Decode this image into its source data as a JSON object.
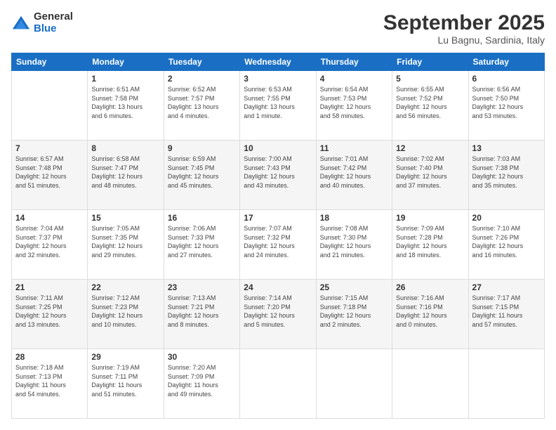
{
  "logo": {
    "general": "General",
    "blue": "Blue"
  },
  "header": {
    "title": "September 2025",
    "location": "Lu Bagnu, Sardinia, Italy"
  },
  "calendar": {
    "days_of_week": [
      "Sunday",
      "Monday",
      "Tuesday",
      "Wednesday",
      "Thursday",
      "Friday",
      "Saturday"
    ],
    "weeks": [
      [
        {
          "day": "",
          "info": ""
        },
        {
          "day": "1",
          "info": "Sunrise: 6:51 AM\nSunset: 7:58 PM\nDaylight: 13 hours\nand 6 minutes."
        },
        {
          "day": "2",
          "info": "Sunrise: 6:52 AM\nSunset: 7:57 PM\nDaylight: 13 hours\nand 4 minutes."
        },
        {
          "day": "3",
          "info": "Sunrise: 6:53 AM\nSunset: 7:55 PM\nDaylight: 13 hours\nand 1 minute."
        },
        {
          "day": "4",
          "info": "Sunrise: 6:54 AM\nSunset: 7:53 PM\nDaylight: 12 hours\nand 58 minutes."
        },
        {
          "day": "5",
          "info": "Sunrise: 6:55 AM\nSunset: 7:52 PM\nDaylight: 12 hours\nand 56 minutes."
        },
        {
          "day": "6",
          "info": "Sunrise: 6:56 AM\nSunset: 7:50 PM\nDaylight: 12 hours\nand 53 minutes."
        }
      ],
      [
        {
          "day": "7",
          "info": "Sunrise: 6:57 AM\nSunset: 7:48 PM\nDaylight: 12 hours\nand 51 minutes."
        },
        {
          "day": "8",
          "info": "Sunrise: 6:58 AM\nSunset: 7:47 PM\nDaylight: 12 hours\nand 48 minutes."
        },
        {
          "day": "9",
          "info": "Sunrise: 6:59 AM\nSunset: 7:45 PM\nDaylight: 12 hours\nand 45 minutes."
        },
        {
          "day": "10",
          "info": "Sunrise: 7:00 AM\nSunset: 7:43 PM\nDaylight: 12 hours\nand 43 minutes."
        },
        {
          "day": "11",
          "info": "Sunrise: 7:01 AM\nSunset: 7:42 PM\nDaylight: 12 hours\nand 40 minutes."
        },
        {
          "day": "12",
          "info": "Sunrise: 7:02 AM\nSunset: 7:40 PM\nDaylight: 12 hours\nand 37 minutes."
        },
        {
          "day": "13",
          "info": "Sunrise: 7:03 AM\nSunset: 7:38 PM\nDaylight: 12 hours\nand 35 minutes."
        }
      ],
      [
        {
          "day": "14",
          "info": "Sunrise: 7:04 AM\nSunset: 7:37 PM\nDaylight: 12 hours\nand 32 minutes."
        },
        {
          "day": "15",
          "info": "Sunrise: 7:05 AM\nSunset: 7:35 PM\nDaylight: 12 hours\nand 29 minutes."
        },
        {
          "day": "16",
          "info": "Sunrise: 7:06 AM\nSunset: 7:33 PM\nDaylight: 12 hours\nand 27 minutes."
        },
        {
          "day": "17",
          "info": "Sunrise: 7:07 AM\nSunset: 7:32 PM\nDaylight: 12 hours\nand 24 minutes."
        },
        {
          "day": "18",
          "info": "Sunrise: 7:08 AM\nSunset: 7:30 PM\nDaylight: 12 hours\nand 21 minutes."
        },
        {
          "day": "19",
          "info": "Sunrise: 7:09 AM\nSunset: 7:28 PM\nDaylight: 12 hours\nand 18 minutes."
        },
        {
          "day": "20",
          "info": "Sunrise: 7:10 AM\nSunset: 7:26 PM\nDaylight: 12 hours\nand 16 minutes."
        }
      ],
      [
        {
          "day": "21",
          "info": "Sunrise: 7:11 AM\nSunset: 7:25 PM\nDaylight: 12 hours\nand 13 minutes."
        },
        {
          "day": "22",
          "info": "Sunrise: 7:12 AM\nSunset: 7:23 PM\nDaylight: 12 hours\nand 10 minutes."
        },
        {
          "day": "23",
          "info": "Sunrise: 7:13 AM\nSunset: 7:21 PM\nDaylight: 12 hours\nand 8 minutes."
        },
        {
          "day": "24",
          "info": "Sunrise: 7:14 AM\nSunset: 7:20 PM\nDaylight: 12 hours\nand 5 minutes."
        },
        {
          "day": "25",
          "info": "Sunrise: 7:15 AM\nSunset: 7:18 PM\nDaylight: 12 hours\nand 2 minutes."
        },
        {
          "day": "26",
          "info": "Sunrise: 7:16 AM\nSunset: 7:16 PM\nDaylight: 12 hours\nand 0 minutes."
        },
        {
          "day": "27",
          "info": "Sunrise: 7:17 AM\nSunset: 7:15 PM\nDaylight: 11 hours\nand 57 minutes."
        }
      ],
      [
        {
          "day": "28",
          "info": "Sunrise: 7:18 AM\nSunset: 7:13 PM\nDaylight: 11 hours\nand 54 minutes."
        },
        {
          "day": "29",
          "info": "Sunrise: 7:19 AM\nSunset: 7:11 PM\nDaylight: 11 hours\nand 51 minutes."
        },
        {
          "day": "30",
          "info": "Sunrise: 7:20 AM\nSunset: 7:09 PM\nDaylight: 11 hours\nand 49 minutes."
        },
        {
          "day": "",
          "info": ""
        },
        {
          "day": "",
          "info": ""
        },
        {
          "day": "",
          "info": ""
        },
        {
          "day": "",
          "info": ""
        }
      ]
    ]
  }
}
